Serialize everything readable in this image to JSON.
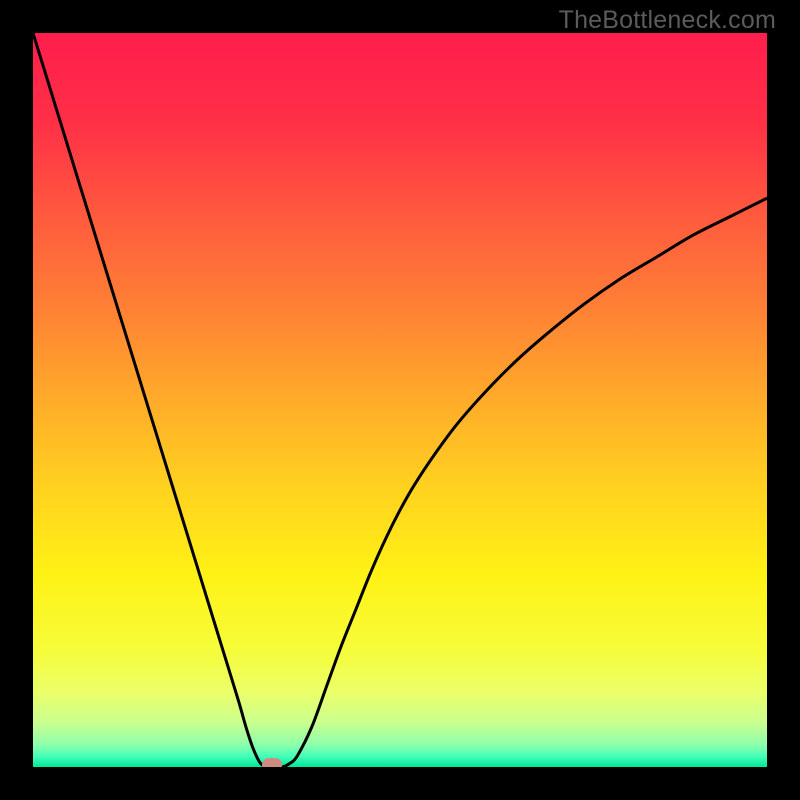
{
  "site_label": "TheBottleneck.com",
  "colors": {
    "frame": "#000000",
    "curve_stroke": "#000000",
    "marker": "#cf8a82",
    "gradient_stops": [
      {
        "offset": 0.0,
        "color": "#ff1e4c"
      },
      {
        "offset": 0.12,
        "color": "#ff2f47"
      },
      {
        "offset": 0.25,
        "color": "#ff5a3e"
      },
      {
        "offset": 0.38,
        "color": "#ff8234"
      },
      {
        "offset": 0.5,
        "color": "#ffab2a"
      },
      {
        "offset": 0.62,
        "color": "#ffd21f"
      },
      {
        "offset": 0.74,
        "color": "#fff215"
      },
      {
        "offset": 0.84,
        "color": "#f6fc3a"
      },
      {
        "offset": 0.9,
        "color": "#eaff6a"
      },
      {
        "offset": 0.94,
        "color": "#c9ff8f"
      },
      {
        "offset": 0.97,
        "color": "#8cffab"
      },
      {
        "offset": 0.985,
        "color": "#47ffb9"
      },
      {
        "offset": 1.0,
        "color": "#00e89a"
      }
    ]
  },
  "chart_data": {
    "type": "line",
    "title": "",
    "xlabel": "",
    "ylabel": "",
    "xlim": [
      0,
      100
    ],
    "ylim": [
      0,
      100
    ],
    "series": [
      {
        "name": "bottleneck-curve",
        "x": [
          0,
          2,
          4,
          6,
          8,
          10,
          12,
          14,
          16,
          18,
          20,
          22,
          24,
          26,
          28,
          29,
          30,
          31,
          32,
          33,
          34,
          35,
          36,
          38,
          40,
          42,
          44,
          46,
          48,
          50,
          52,
          55,
          58,
          62,
          66,
          70,
          75,
          80,
          85,
          90,
          95,
          100
        ],
        "y": [
          100,
          93.5,
          87,
          80.5,
          74,
          67.5,
          61,
          54.5,
          48,
          41.5,
          35,
          28.5,
          22,
          15.5,
          9,
          5.5,
          2.5,
          0.5,
          0,
          0,
          0,
          0.5,
          1.5,
          5.5,
          11,
          16.5,
          21.5,
          26.5,
          31,
          35,
          38.5,
          43,
          47,
          51.5,
          55.5,
          59,
          63,
          66.5,
          69.5,
          72.5,
          75,
          77.5
        ]
      }
    ],
    "marker": {
      "x": 32.5,
      "y": 0.3
    },
    "grid": false,
    "legend": false
  }
}
